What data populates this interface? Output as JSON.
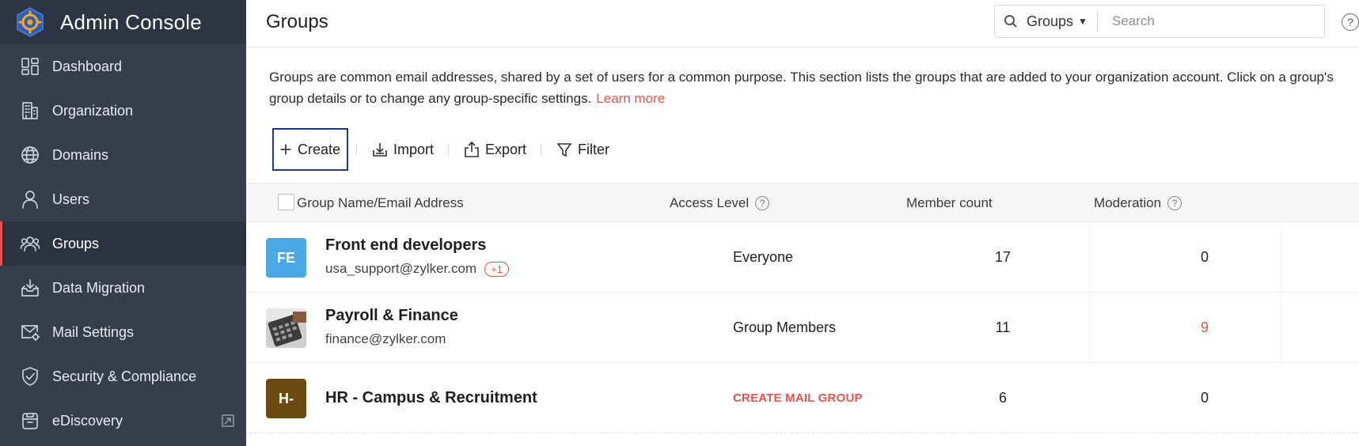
{
  "sidebar": {
    "title": "Admin Console",
    "items": [
      {
        "label": "Dashboard",
        "icon": "dashboard-icon"
      },
      {
        "label": "Organization",
        "icon": "building-icon"
      },
      {
        "label": "Domains",
        "icon": "globe-icon"
      },
      {
        "label": "Users",
        "icon": "user-icon"
      },
      {
        "label": "Groups",
        "icon": "group-icon",
        "active": true
      },
      {
        "label": "Data Migration",
        "icon": "inbox-download-icon"
      },
      {
        "label": "Mail Settings",
        "icon": "mail-gear-icon"
      },
      {
        "label": "Security & Compliance",
        "icon": "shield-check-icon"
      },
      {
        "label": "eDiscovery",
        "icon": "archive-icon",
        "external": true
      }
    ]
  },
  "header": {
    "title": "Groups",
    "search_scope": "Groups",
    "search_placeholder": "Search",
    "help": "?"
  },
  "description": {
    "line1": "Groups are common email addresses, shared by a set of users for a common purpose. This section lists the groups that are added to your organization account. Click on a group's",
    "line2": "group details or to change any group-specific settings.",
    "learn_more": "Learn more"
  },
  "toolbar": {
    "create": "Create",
    "import": "Import",
    "export": "Export",
    "filter": "Filter"
  },
  "table": {
    "columns": {
      "name": "Group Name/Email Address",
      "access": "Access Level",
      "members": "Member count",
      "moderation": "Moderation"
    },
    "rows": [
      {
        "initials": "FE",
        "avatar_color": "#4aa9e4",
        "name": "Front end developers",
        "email": "usa_support@zylker.com",
        "extra": "+1",
        "access": "Everyone",
        "members": "17",
        "moderation": "0"
      },
      {
        "initials": "",
        "avatar_color": "#c9c9c9",
        "name": "Payroll & Finance",
        "email": "finance@zylker.com",
        "extra": "",
        "access": "Group Members",
        "members": "11",
        "moderation": "9"
      },
      {
        "initials": "H-",
        "avatar_color": "#6b4a12",
        "name": "HR - Campus & Recruitment",
        "email": "",
        "extra": "",
        "access": "CREATE MAIL GROUP",
        "members": "6",
        "moderation": "0"
      }
    ]
  },
  "colors": {
    "sidebar_bg": "#363e4d",
    "accent": "#e8524f",
    "create_border": "#1c3a8a"
  }
}
